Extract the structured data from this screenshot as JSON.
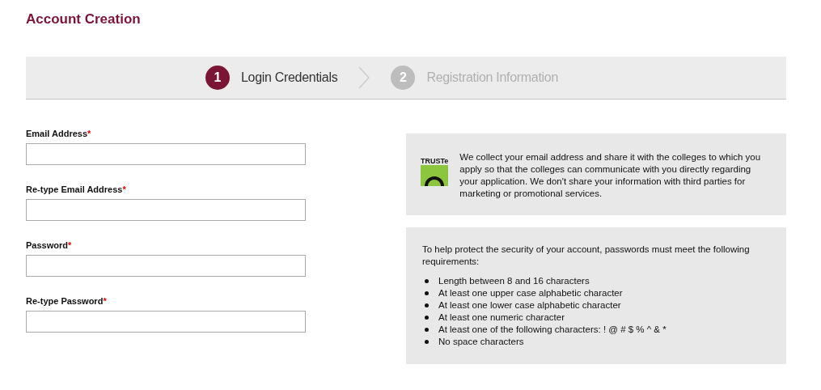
{
  "title": "Account Creation",
  "steps": [
    {
      "number": "1",
      "label": "Login Credentials",
      "selected": true
    },
    {
      "number": "2",
      "label": "Registration Information",
      "selected": false
    }
  ],
  "fields": [
    {
      "label": "Email Address",
      "required_mark": "*"
    },
    {
      "label": "Re-type Email Address",
      "required_mark": "*"
    },
    {
      "label": "Password",
      "required_mark": "*"
    },
    {
      "label": "Re-type Password",
      "required_mark": "*"
    }
  ],
  "privacy": {
    "badge": "TRUSTe",
    "text": "We collect your email address and share it with the colleges to which you apply so that the colleges can communicate with you directly regarding your application. We don't share your information with third parties for marketing or promotional services."
  },
  "requirements": {
    "intro": "To help protect the security of your account, passwords must meet the following requirements:",
    "items": [
      "Length between 8 and 16 characters",
      "At least one upper case alphabetic character",
      "At least one lower case alphabetic character",
      "At least one numeric character",
      "At least one of the following characters: ! @ # $ % ^ & *",
      "No space characters"
    ]
  }
}
